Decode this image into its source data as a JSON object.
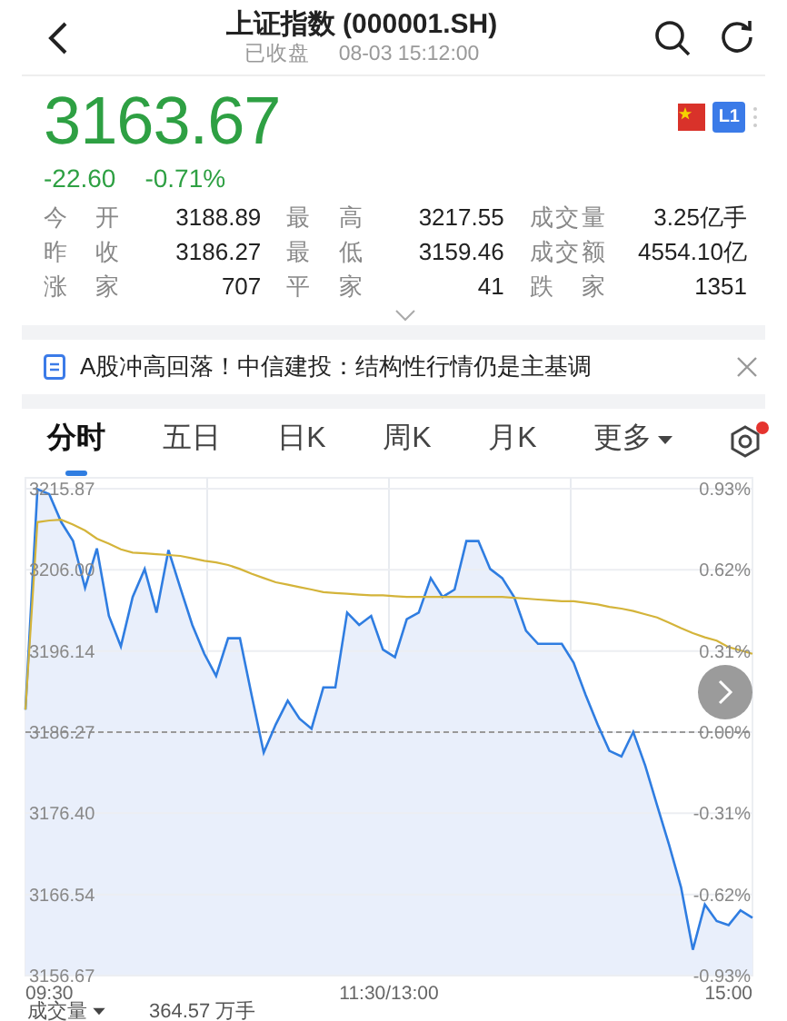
{
  "header": {
    "title": "上证指数 (000001.SH)",
    "status": "已收盘",
    "time": "08-03 15:12:00"
  },
  "quote": {
    "price": "3163.67",
    "change": "-22.60",
    "change_pct": "-0.71%",
    "badge": "L1"
  },
  "stats": [
    {
      "label": "今开",
      "value": "3188.89"
    },
    {
      "label": "最高",
      "value": "3217.55"
    },
    {
      "label": "成交量",
      "value": "3.25亿手"
    },
    {
      "label": "昨收",
      "value": "3186.27"
    },
    {
      "label": "最低",
      "value": "3159.46"
    },
    {
      "label": "成交额",
      "value": "4554.10亿"
    },
    {
      "label": "涨家",
      "value": "707"
    },
    {
      "label": "平家",
      "value": "41"
    },
    {
      "label": "跌家",
      "value": "1351"
    }
  ],
  "news": {
    "text": "A股冲高回落！中信建投：结构性行情仍是主基调"
  },
  "tabs": [
    {
      "label": "分时",
      "selected": true
    },
    {
      "label": "五日",
      "selected": false
    },
    {
      "label": "日K",
      "selected": false
    },
    {
      "label": "周K",
      "selected": false
    },
    {
      "label": "月K",
      "selected": false
    },
    {
      "label": "更多",
      "selected": false,
      "kind": "dropdown"
    }
  ],
  "settings": {
    "notification": true
  },
  "chart": {
    "time_labels": [
      "09:30",
      "11:30/13:00",
      "15:00"
    ],
    "right_axis_labels": [
      "0.93%",
      "0.62%",
      "0.31%",
      "0.00%",
      "-0.31%",
      "-0.62%",
      "-0.93%"
    ],
    "chart_data": {
      "type": "line",
      "categories": [
        null,
        null,
        null,
        null,
        null,
        null,
        null,
        null,
        null,
        null,
        null,
        null,
        null,
        null,
        null,
        null,
        null,
        null,
        null,
        null,
        null,
        null,
        null,
        null,
        null,
        null,
        null,
        null,
        null,
        null,
        null,
        null,
        null,
        null,
        null,
        null,
        null,
        null,
        null,
        null,
        null,
        null,
        null,
        null,
        null,
        null,
        null,
        null,
        null,
        null,
        null,
        null,
        null,
        null,
        null,
        null,
        null,
        null,
        null,
        null,
        null,
        null
      ],
      "series": [
        {
          "type": "area",
          "color": "#2f7de1",
          "values": [
            3189.0,
            3215.8,
            3215.2,
            3211.8,
            3209.5,
            3203.8,
            3208.6,
            3200.4,
            3196.7,
            3202.7,
            3206.1,
            3200.8,
            3208.4,
            3203.8,
            3199.3,
            3195.8,
            3193.1,
            3197.7,
            3197.7,
            3190.6,
            3183.8,
            3187.2,
            3190.1,
            3187.9,
            3186.7,
            3191.7,
            3191.7,
            3200.8,
            3199.3,
            3200.4,
            3196.3,
            3195.4,
            3200.0,
            3200.8,
            3205.0,
            3202.7,
            3203.6,
            3209.5,
            3209.5,
            3206.1,
            3205.0,
            3202.7,
            3198.6,
            3197.0,
            3197.0,
            3197.0,
            3194.7,
            3190.8,
            3187.2,
            3184.0,
            3183.3,
            3186.3,
            3182.2,
            3177.4,
            3172.6,
            3167.4,
            3159.8,
            3165.3,
            3163.3,
            3162.8,
            3164.6,
            3163.7
          ]
        },
        {
          "color": "#d4b43a",
          "values": [
            3189.0,
            3211.8,
            3212.0,
            3212.1,
            3211.5,
            3210.8,
            3209.8,
            3209.2,
            3208.5,
            3208.1,
            3208.0,
            3207.9,
            3207.8,
            3207.7,
            3207.4,
            3207.1,
            3206.9,
            3206.6,
            3206.1,
            3205.5,
            3205.0,
            3204.5,
            3204.2,
            3203.9,
            3203.6,
            3203.3,
            3203.2,
            3203.1,
            3203.0,
            3202.9,
            3202.9,
            3202.8,
            3202.7,
            3202.7,
            3202.7,
            3202.7,
            3202.7,
            3202.7,
            3202.7,
            3202.7,
            3202.7,
            3202.6,
            3202.5,
            3202.4,
            3202.3,
            3202.2,
            3202.2,
            3202.0,
            3201.8,
            3201.5,
            3201.3,
            3201.0,
            3200.6,
            3200.2,
            3199.6,
            3198.9,
            3198.3,
            3197.8,
            3197.4,
            3196.6,
            3196.2,
            3195.8
          ]
        }
      ],
      "ylim": [
        3156.67,
        3215.87
      ],
      "grid": true,
      "ref_lines": [
        {
          "axis": "y",
          "value": 3186.27
        }
      ],
      "yticks": [
        {
          "value": 3215.87,
          "label": "3215.87"
        },
        {
          "value": 3206.0,
          "label": "3206.00"
        },
        {
          "value": 3196.14,
          "label": "3196.14"
        },
        {
          "value": 3186.27,
          "label": "3186.27"
        },
        {
          "value": 3176.4,
          "label": "3176.40"
        },
        {
          "value": 3166.54,
          "label": "3166.54"
        },
        {
          "value": 3156.67,
          "label": "3156.67"
        }
      ]
    }
  },
  "volume": {
    "label": "成交量",
    "value": "364.57 万手"
  }
}
